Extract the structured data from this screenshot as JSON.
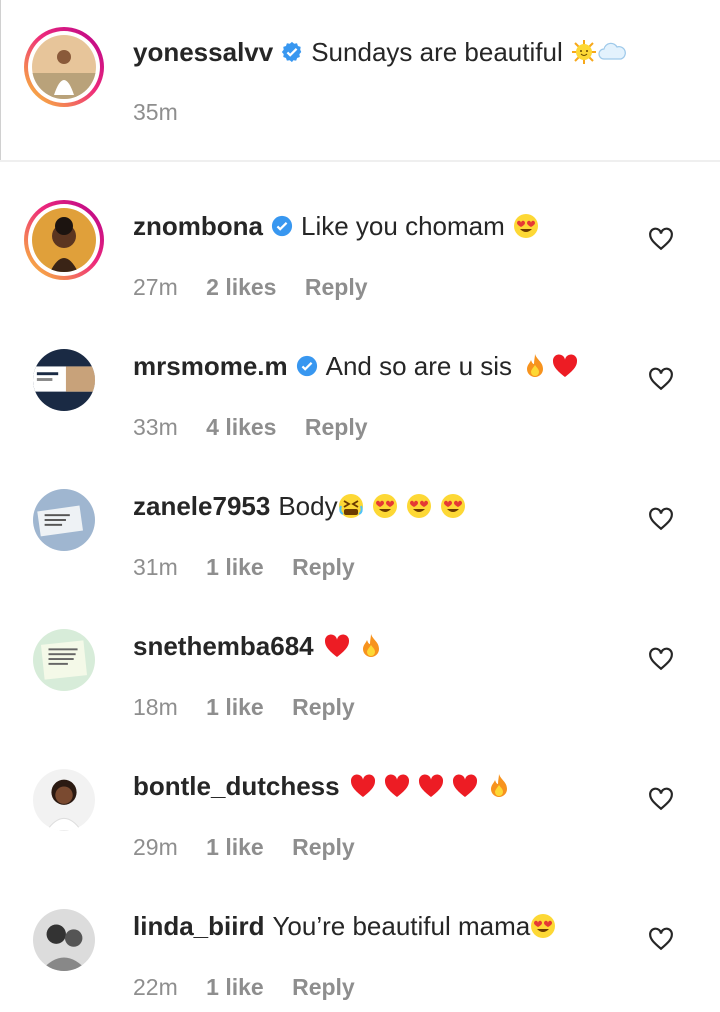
{
  "caption": {
    "username": "yonessalvv",
    "text": "Sundays are beautiful",
    "time": "35m",
    "emojis": [
      "sun-emoji",
      "cloud-emoji"
    ]
  },
  "comments": [
    {
      "username": "znombona",
      "verified": true,
      "text": "Like you chomam",
      "time": "27m",
      "likes": "2 likes",
      "reply": "Reply",
      "emojis": [
        "heart-eyes-emoji"
      ]
    },
    {
      "username": "mrsmome.m",
      "verified": true,
      "text": "And so are u sis",
      "time": "33m",
      "likes": "4 likes",
      "reply": "Reply",
      "emojis": [
        "fire-emoji",
        "red-heart-emoji"
      ]
    },
    {
      "username": "zanele7953",
      "verified": false,
      "text": "Body",
      "time": "31m",
      "likes": "1 like",
      "reply": "Reply",
      "emojis": [
        "tired-face-emoji",
        "heart-eyes-emoji",
        "heart-eyes-emoji",
        "heart-eyes-emoji"
      ]
    },
    {
      "username": "snethemba684",
      "verified": false,
      "text": "",
      "time": "18m",
      "likes": "1 like",
      "reply": "Reply",
      "emojis": [
        "red-heart-emoji",
        "fire-emoji"
      ]
    },
    {
      "username": "bontle_dutchess",
      "verified": false,
      "text": "",
      "time": "29m",
      "likes": "1 like",
      "reply": "Reply",
      "emojis": [
        "red-heart-emoji",
        "red-heart-emoji",
        "red-heart-emoji",
        "red-heart-emoji",
        "fire-emoji"
      ]
    },
    {
      "username": "linda_biird",
      "verified": false,
      "text": "You’re beautiful mama",
      "time": "22m",
      "likes": "1 like",
      "reply": "Reply",
      "emojis": [
        "heart-eyes-emoji"
      ]
    }
  ],
  "colors": {
    "verified": "#3897f0",
    "muted": "#8e8e8e",
    "text": "#262626",
    "heart": "#ed1c24",
    "fire": "#f7931e"
  }
}
